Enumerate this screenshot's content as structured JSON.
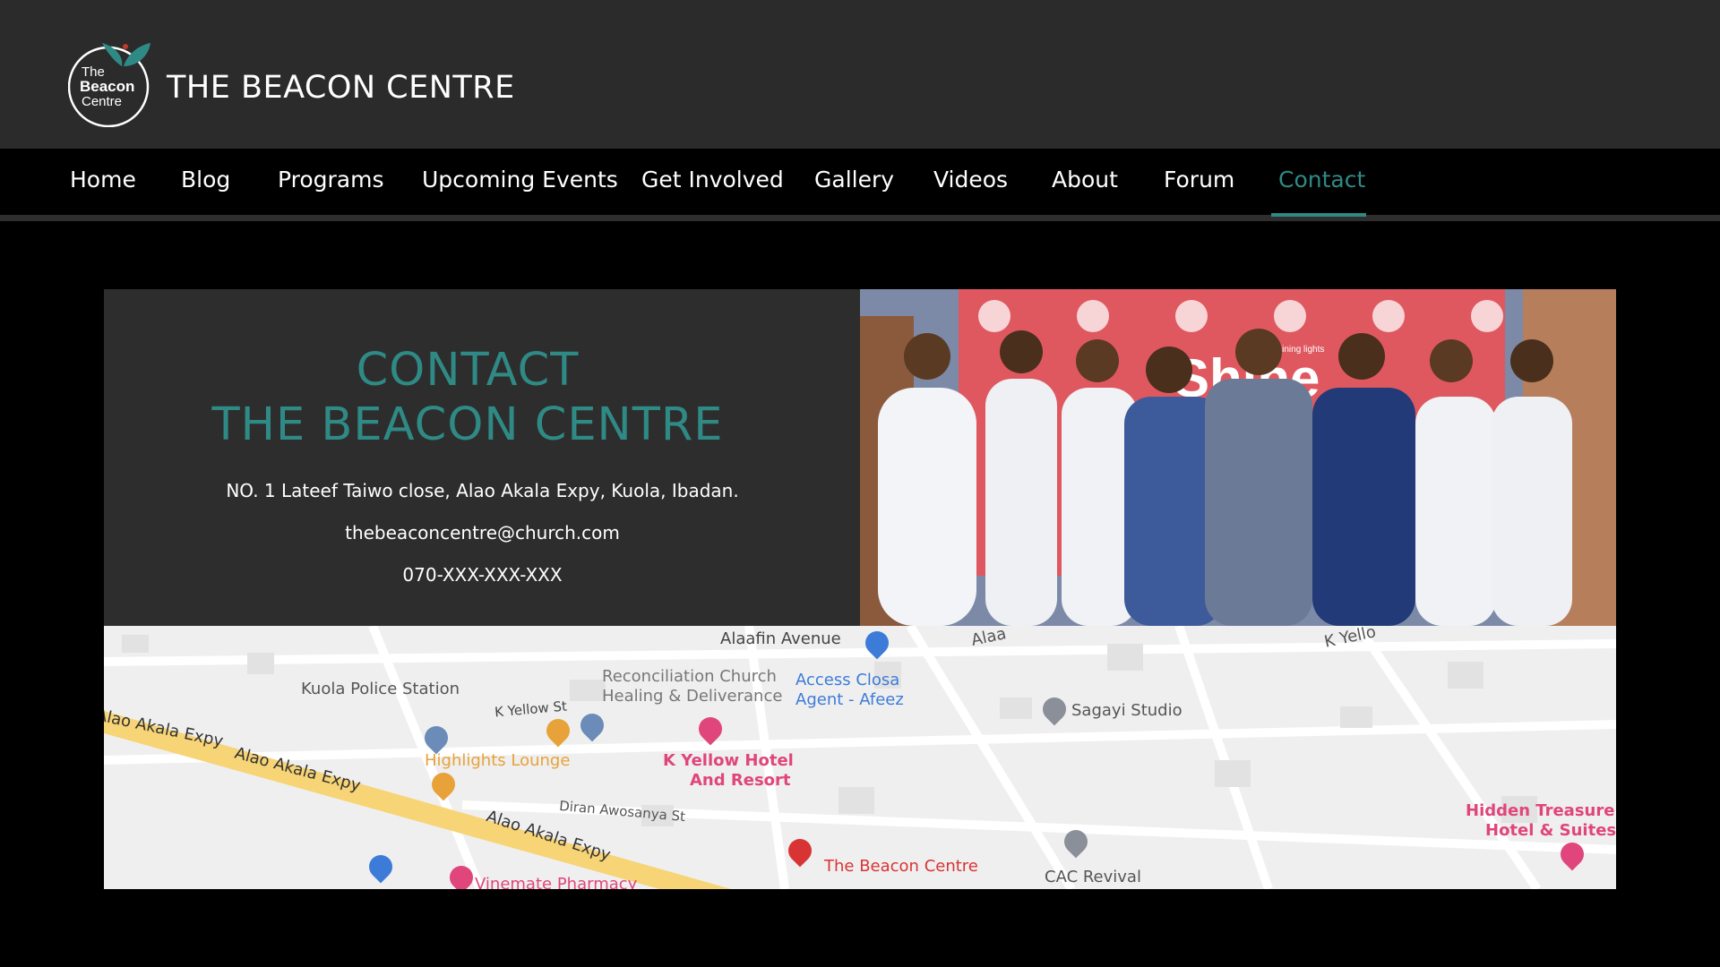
{
  "header": {
    "logo_text": [
      "The",
      "Beacon",
      "Centre"
    ],
    "site_title": "THE BEACON CENTRE"
  },
  "nav": {
    "items": [
      {
        "label": "Home"
      },
      {
        "label": "Blog"
      },
      {
        "label": "Programs"
      },
      {
        "label": "Upcoming Events"
      },
      {
        "label": "Get Involved"
      },
      {
        "label": "Gallery"
      },
      {
        "label": "Videos"
      },
      {
        "label": "About"
      },
      {
        "label": "Forum"
      },
      {
        "label": "Contact"
      }
    ],
    "active": "Contact"
  },
  "contact": {
    "heading_line1": "CONTACT",
    "heading_line2": "THE BEACON CENTRE",
    "address": "NO. 1 Lateef Taiwo close, Alao Akala Expy, Kuola, Ibadan.",
    "email": "thebeaconcentre@church.com",
    "phone": "070-XXX-XXX-XXX"
  },
  "photo": {
    "backdrop_text": "Shine",
    "badge_text": "...raising shining lights"
  },
  "map": {
    "labels": {
      "alaafin": "Alaafin Avenue",
      "kuola_police": "Kuola Police Station",
      "reconciliation": "Reconciliation Church Healing & Deliverance",
      "reconciliation_1": "Reconciliation Church",
      "reconciliation_2": "Healing & Deliverance",
      "access": "Access Closa Agent - Afeez",
      "access_1": "Access Closa",
      "access_2": "Agent - Afeez",
      "sagayi": "Sagayi Studio",
      "kyellow_st": "K Yellow St",
      "alao_1": "Alao Akala Expy",
      "alao_2": "Alao Akala Expy",
      "alao_3": "Alao Akala Expy",
      "highlights": "Highlights Lounge",
      "kyellow_hotel_1": "K Yellow Hotel",
      "kyellow_hotel_2": "And Resort",
      "diran": "Diran Awosanya St",
      "beacon": "The Beacon Centre",
      "cac": "CAC Revival",
      "hidden_1": "Hidden Treasure",
      "hidden_2": "Hotel & Suites",
      "vinemate": "Vinemate Pharmacy",
      "alaa": "Alaa",
      "kyello": "K Yello"
    }
  },
  "colors": {
    "accent": "#2f8a85",
    "header_bg": "#2b2b2b",
    "panel_bg": "#2d2d2d",
    "page_bg": "#000000"
  }
}
